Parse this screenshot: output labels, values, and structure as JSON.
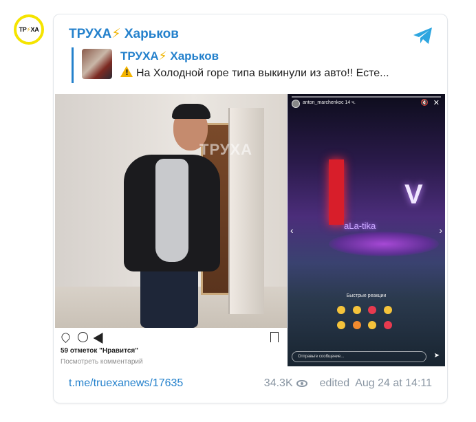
{
  "channel": {
    "name_prefix": "ТРУХА",
    "bolt": "⚡",
    "name_suffix": "Харьков",
    "avatar_text_left": "ТР",
    "avatar_text_right": "ХА",
    "accent_color": "#2481cc"
  },
  "reply": {
    "title_prefix": "ТРУХА",
    "title_bolt": "⚡",
    "title_suffix": "Харьков",
    "text": "На Холодной горе типа выкинули из авто!! Есте..."
  },
  "media_left": {
    "watermark": "ТРУХА",
    "likes": "59 отметок \"Нравится\"",
    "comments_link": "Посмотреть комментарий"
  },
  "media_right": {
    "username": "anton_marchenkoc  14 ч.",
    "neon_sign": "V",
    "neon_text": "аLa-tika",
    "reactions_label": "Быстрые реакции",
    "reply_placeholder": "Отправьте сообщение..."
  },
  "footer": {
    "link": "t.me/truexanews/17635",
    "views": "34.3K",
    "edited": "edited",
    "date": "Aug 24 at 14:11"
  }
}
